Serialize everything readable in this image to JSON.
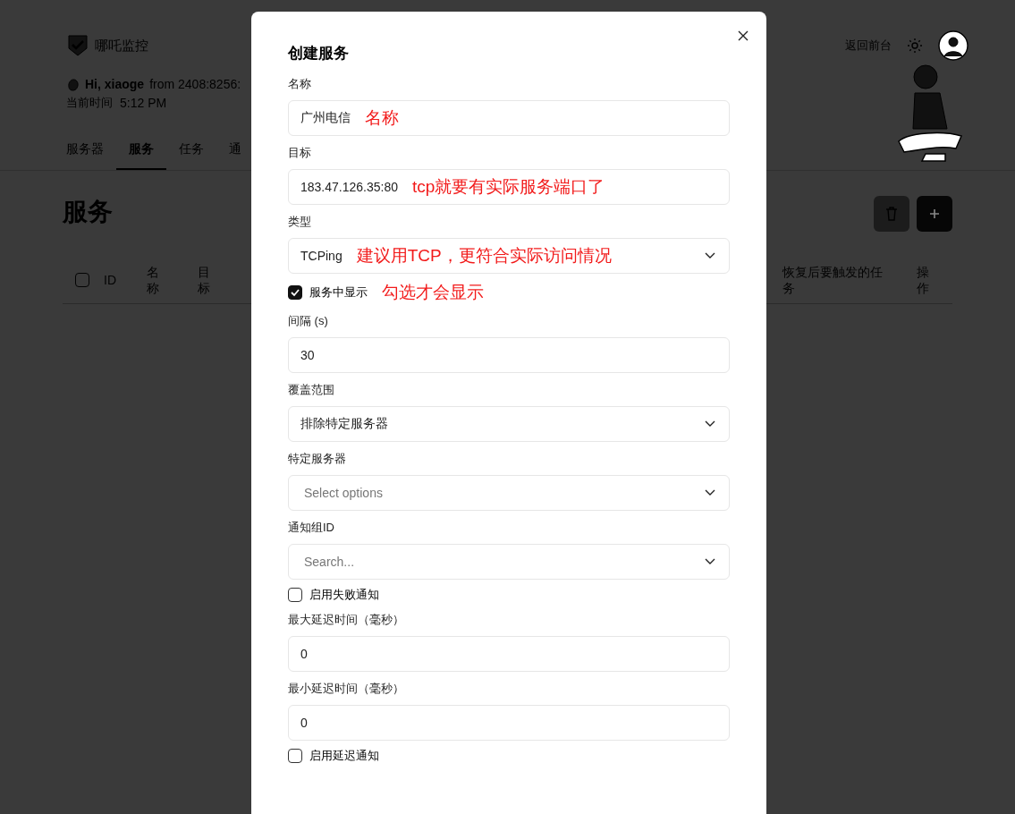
{
  "header": {
    "logo_text": "哪吒监控",
    "links": [
      {
        "label": "返回前台"
      }
    ]
  },
  "greeting": {
    "name": "Hi, xiaoge",
    "from": "from 2408:8256:",
    "time_label": "当前时间",
    "time": "5:12 PM"
  },
  "tabs": [
    {
      "label": "服务器",
      "selected": false
    },
    {
      "label": "服务",
      "selected": true
    },
    {
      "label": "任务",
      "selected": false
    },
    {
      "label": "通",
      "selected": false
    }
  ],
  "page_title": "服务",
  "table": {
    "select_all_checked": false,
    "columns": [
      {
        "label": "ID"
      },
      {
        "label": "名称"
      },
      {
        "label": "目标"
      },
      {
        "label": "恢复后要触发的任务"
      },
      {
        "label": "操作"
      }
    ]
  },
  "dialog": {
    "title": "创建服务",
    "fields": [
      {
        "kind": "text",
        "label": "名称",
        "value": "广州电信",
        "annotation": "名称"
      },
      {
        "kind": "text",
        "label": "目标",
        "value": "183.47.126.35:80",
        "annotation": "tcp就要有实际服务端口了"
      },
      {
        "kind": "select",
        "label": "类型",
        "value": "TCPing",
        "annotation": "建议用TCP，更符合实际访问情况"
      },
      {
        "kind": "checkbox",
        "label": "服务中显示",
        "checked": true,
        "annotation": "勾选才会显示"
      },
      {
        "kind": "text",
        "label": "间隔 (s)",
        "value": "30"
      },
      {
        "kind": "select",
        "label": "覆盖范围",
        "value": "排除特定服务器"
      },
      {
        "kind": "select",
        "label": "特定服务器",
        "placeholder": "Select options"
      },
      {
        "kind": "select",
        "label": "通知组ID",
        "placeholder": "Search..."
      },
      {
        "kind": "checkbox",
        "label": "启用失败通知",
        "checked": false
      },
      {
        "kind": "text",
        "label": "最大延迟时间（毫秒）",
        "value": "0"
      },
      {
        "kind": "text",
        "label": "最小延迟时间（毫秒）",
        "value": "0"
      },
      {
        "kind": "checkbox",
        "label": "启用延迟通知",
        "checked": false
      }
    ]
  }
}
